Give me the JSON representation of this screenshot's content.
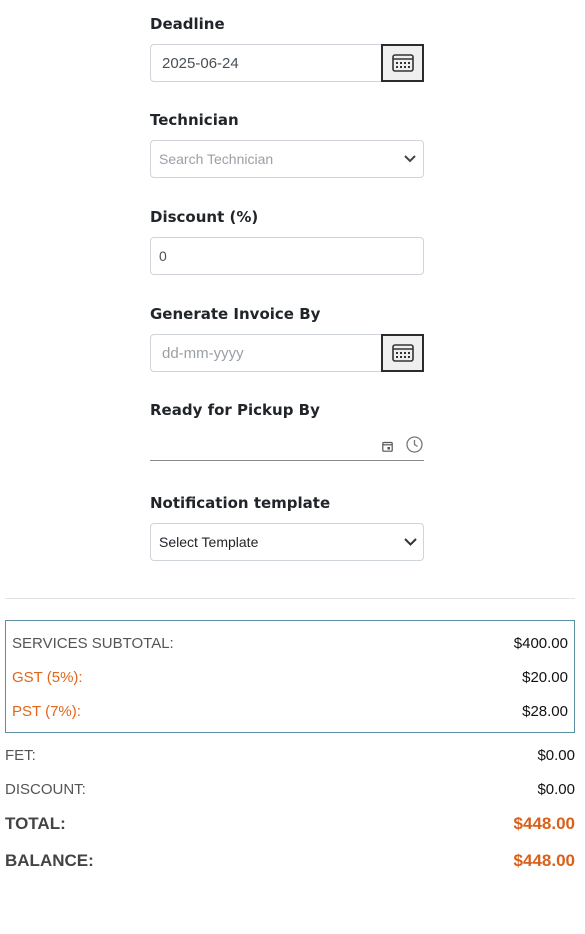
{
  "form": {
    "deadline": {
      "label": "Deadline",
      "value": "2025-06-24"
    },
    "technician": {
      "label": "Technician",
      "placeholder": "Search Technician"
    },
    "discount": {
      "label": "Discount (%)",
      "value": "0"
    },
    "generate_invoice": {
      "label": "Generate Invoice By",
      "placeholder": "dd-mm-yyyy"
    },
    "ready_pickup": {
      "label": "Ready for Pickup By"
    },
    "notification": {
      "label": "Notification template",
      "value": "Select Template"
    }
  },
  "summary": {
    "services_subtotal": {
      "label": "SERVICES SUBTOTAL:",
      "value": "$400.00"
    },
    "gst": {
      "label": "GST (5%):",
      "value": "$20.00"
    },
    "pst": {
      "label": "PST (7%):",
      "value": "$28.00"
    },
    "fet": {
      "label": "FET:",
      "value": "$0.00"
    },
    "discount": {
      "label": "DISCOUNT:",
      "value": "$0.00"
    },
    "total": {
      "label": "TOTAL:",
      "value": "$448.00"
    },
    "balance": {
      "label": "BALANCE:",
      "value": "$448.00"
    }
  },
  "icons": {
    "calendar": "calendar-icon",
    "chevron": "chevron-down-icon",
    "clock": "clock-icon"
  },
  "colors": {
    "accent_orange": "#e0661c",
    "summary_border": "#5d8fa3"
  }
}
